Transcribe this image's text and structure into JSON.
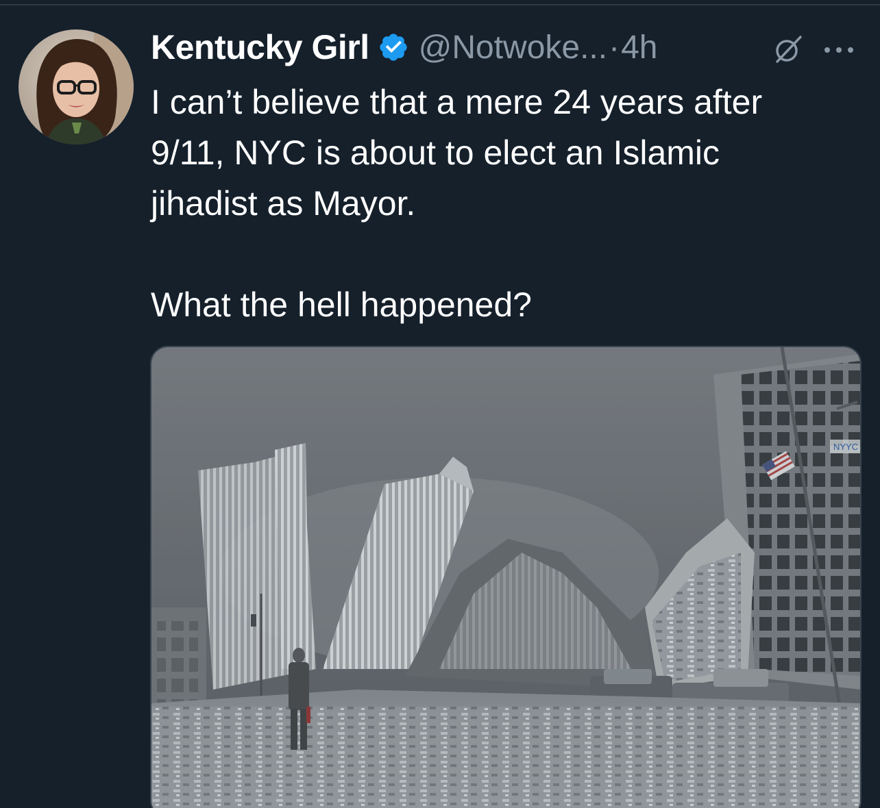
{
  "tweet": {
    "author": {
      "display_name": "Kentucky Girl",
      "handle": "@Notwoke...",
      "verified": true,
      "avatar_icon": "profile-photo"
    },
    "separator": "·",
    "timestamp": "4h",
    "text_lines": [
      "I can’t believe that a mere 24 years after",
      "9/11, NYC is about to elect an Islamic",
      "jihadist as Mayor.",
      "",
      "What the hell happened?"
    ],
    "media": {
      "type": "photo",
      "flag_sign_text": "NYYC"
    },
    "actions": {
      "grok_icon": "grok-icon",
      "more_icon": "more-options-icon"
    }
  },
  "colors": {
    "background": "#15202b",
    "text_primary": "#ffffff",
    "text_secondary": "#8b98a5",
    "verified_blue": "#1d9bf0",
    "media_border": "#38444d"
  }
}
